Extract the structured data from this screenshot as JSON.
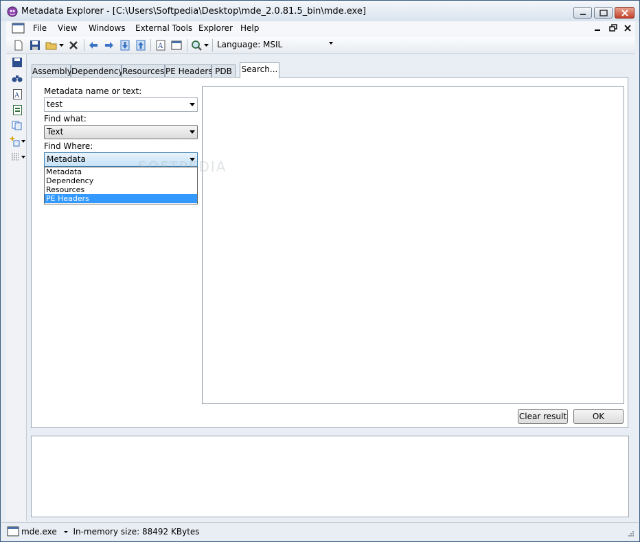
{
  "window": {
    "title": "Metadata Explorer - [C:\\Users\\Softpedia\\Desktop\\mde_2.0.81.5_bin\\mde.exe]"
  },
  "menu": {
    "items": [
      "File",
      "View",
      "Windows",
      "External Tools",
      "Explorer",
      "Help"
    ]
  },
  "toolbar": {
    "language_label": "Language:",
    "language_value": "MSIL"
  },
  "tabs": [
    "Assembly",
    "Dependency",
    "Resources",
    "PE Headers",
    "PDB",
    "Search..."
  ],
  "search": {
    "name_label": "Metadata name or text:",
    "name_value": "test",
    "find_what_label": "Find what:",
    "find_what_value": "Text",
    "find_where_label": "Find Where:",
    "find_where_value": "Metadata",
    "find_where_options": [
      "Metadata",
      "Dependency",
      "Resources",
      "PE Headers"
    ],
    "selected_option": "PE Headers"
  },
  "buttons": {
    "clear": "Clear result",
    "ok": "OK"
  },
  "status": {
    "file": "mde.exe",
    "memory": "In-memory size: 88492 KBytes"
  },
  "watermark": "SOFTPEDIA"
}
